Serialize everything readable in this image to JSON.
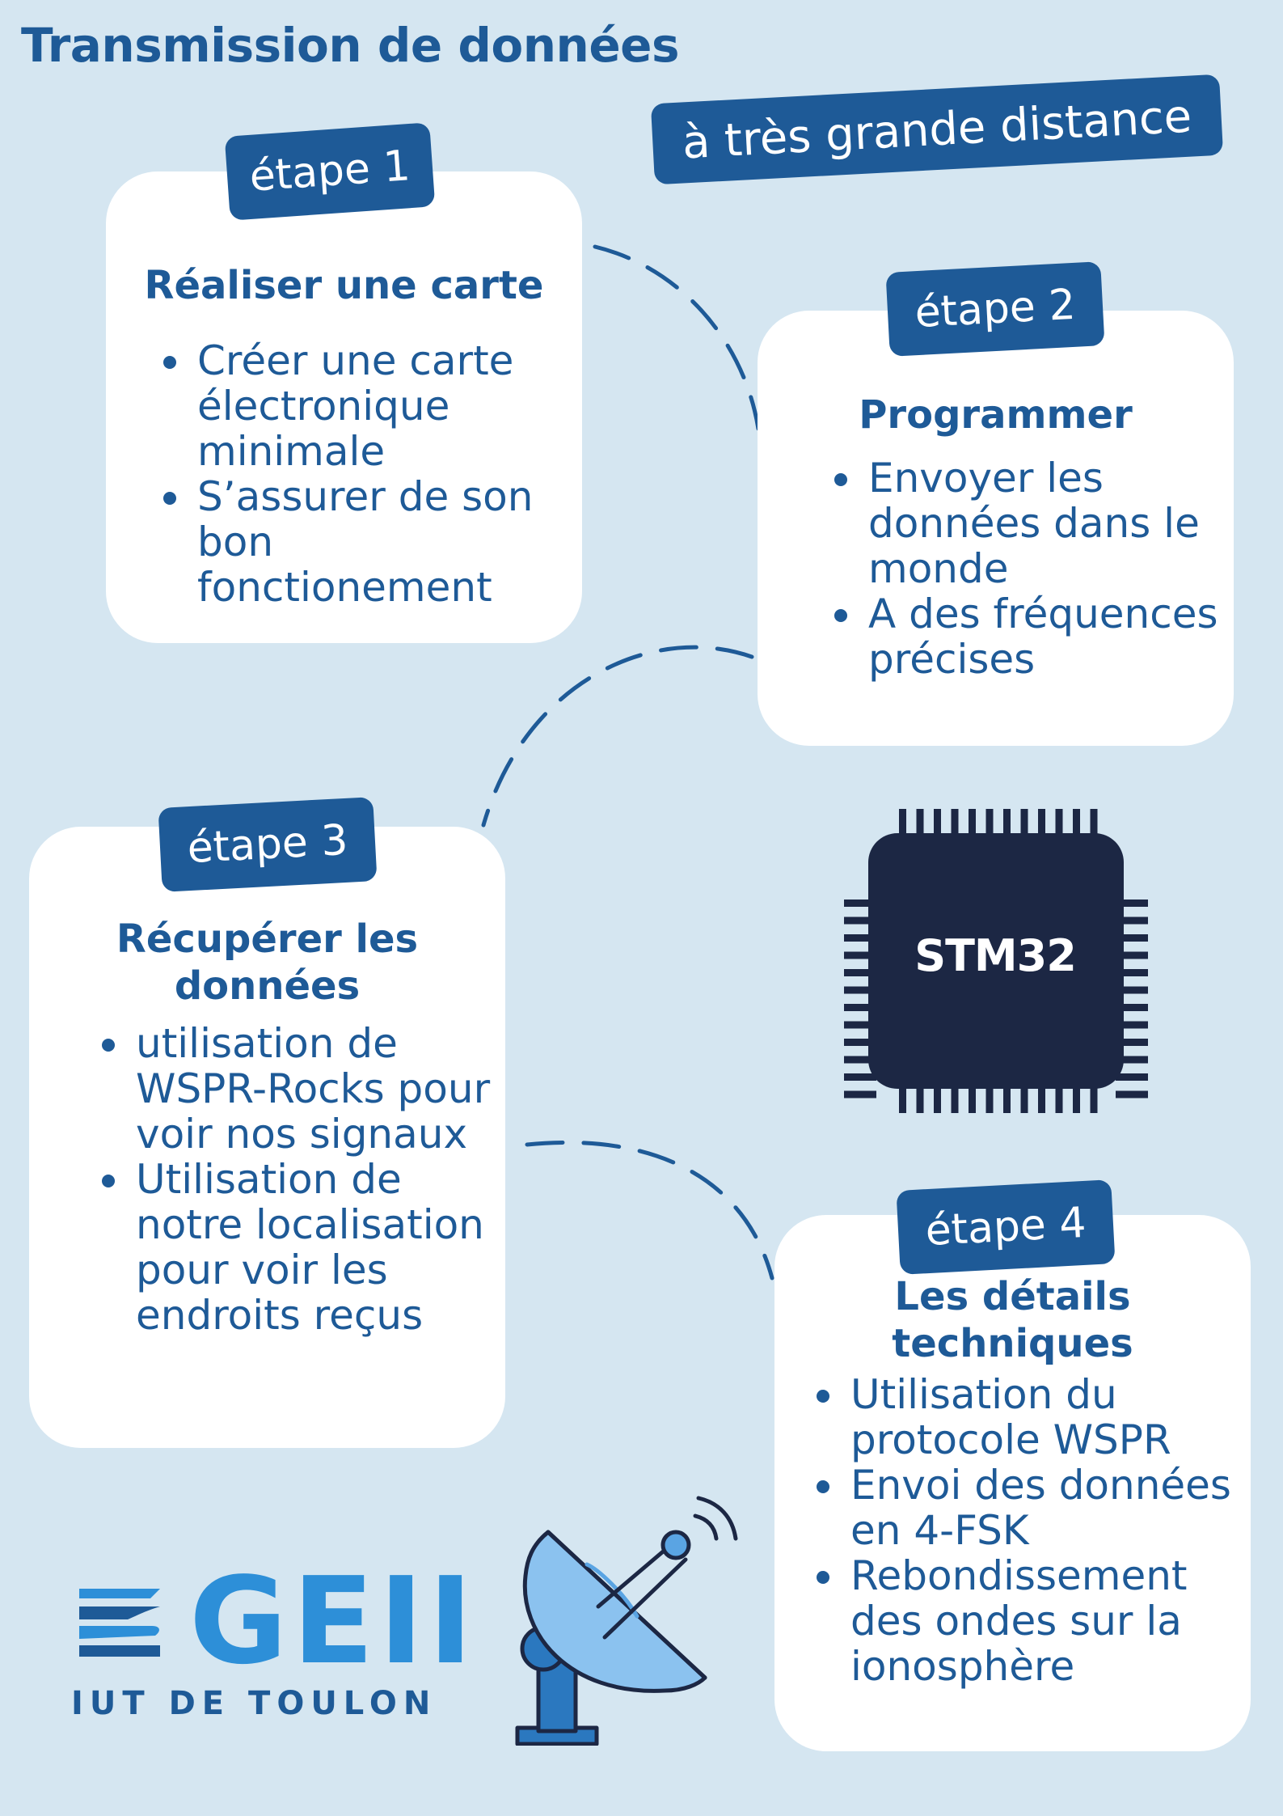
{
  "title": "Transmission de données",
  "subtitle": "à très grande distance",
  "steps": [
    {
      "badge": "étape 1",
      "title": "Réaliser une carte",
      "bullets": [
        "Créer une carte électronique minimale",
        "S’assurer de son bon fonctionement"
      ]
    },
    {
      "badge": "étape 2",
      "title": "Programmer",
      "bullets": [
        "Envoyer les données dans le monde",
        "A des fréquences précises"
      ]
    },
    {
      "badge": "étape 3",
      "title": "Récupérer les données",
      "bullets": [
        "utilisation de WSPR-Rocks pour voir nos signaux",
        "Utilisation de notre localisation pour voir les endroits reçus"
      ]
    },
    {
      "badge": "étape 4",
      "title": "Les détails techniques",
      "bullets": [
        "Utilisation du protocole WSPR",
        "Envoi des données en 4-FSK",
        "Rebondissement des ondes sur la ionosphère"
      ]
    }
  ],
  "chip": {
    "label": "STM32",
    "icon": "microcontroller-chip-icon"
  },
  "dish": {
    "icon": "satellite-dish-icon"
  },
  "logo": {
    "name": "GEII",
    "subtitle": "IUT DE TOULON"
  },
  "colors": {
    "background": "#d5e6f1",
    "primary": "#1e5a97",
    "logo_blue": "#2d8fd8",
    "chip": "#1c2744"
  }
}
